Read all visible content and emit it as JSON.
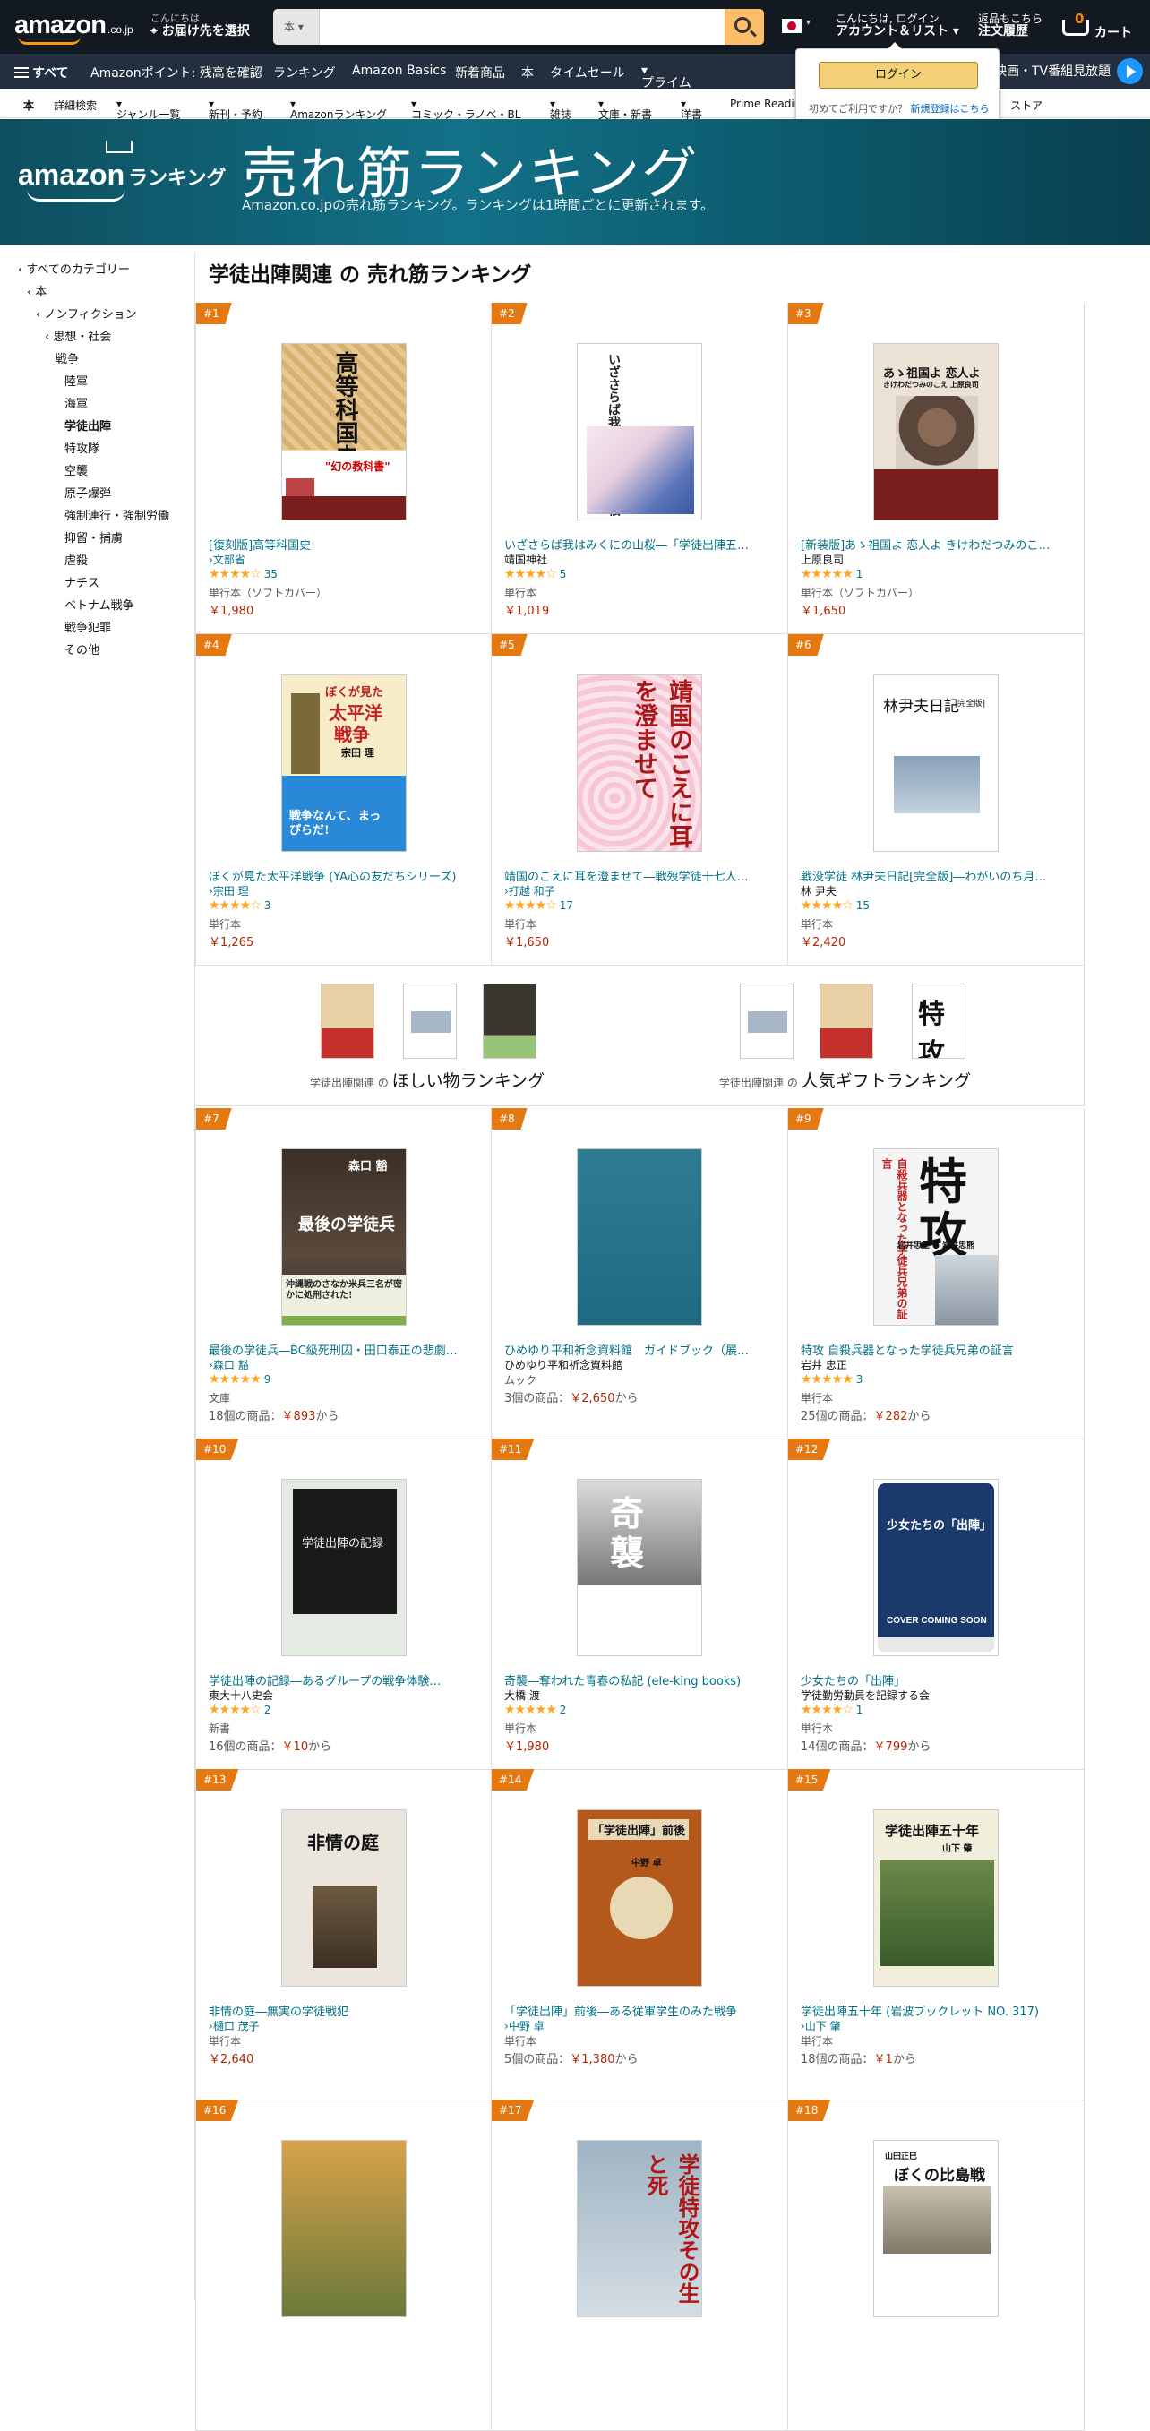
{
  "header": {
    "logo": "amazon",
    "logo_domain": ".co.jp",
    "deliver_line1": "こんにちは",
    "deliver_line2": "お届け先を選択",
    "search_category": "本",
    "search_placeholder": "",
    "account_line1": "こんにちは, ログイン",
    "account_line2": "アカウント＆リスト",
    "orders_line1": "返品もこちら",
    "orders_line2": "注文履歴",
    "cart_count": "0",
    "cart_label": "カート"
  },
  "nav": {
    "all": "すべて",
    "items": [
      "Amazonポイント: 残高を確認",
      "ランキング",
      "Amazon Basics",
      "新着商品",
      "本",
      "タイムセール",
      "プライム"
    ],
    "prime_video": "映画・TV番組見放題"
  },
  "subnav": [
    "本",
    "詳細検索",
    "ジャンル一覧",
    "新刊・予約",
    "Amazonランキング",
    "コミック・ラノベ・BL",
    "雑誌",
    "文庫・新書",
    "洋書",
    "Prime Reading",
    "ストア"
  ],
  "signin_popover": {
    "button": "ログイン",
    "text": "初めてご利用ですか？",
    "link": "新規登録はこちら"
  },
  "banner": {
    "logo_text": "amazon",
    "logo_sub": "ランキング",
    "title": "売れ筋ランキング",
    "subtitle": "Amazon.co.jpの売れ筋ランキング。ランキングは1時間ごとに更新されます。"
  },
  "sidebar": [
    "‹ すべてのカテゴリー",
    "‹ 本",
    "‹ ノンフィクション",
    "‹ 思想・社会",
    "戦争",
    "陸軍",
    "海軍",
    "学徒出陣",
    "特攻隊",
    "空襲",
    "原子爆弾",
    "強制連行・強制労働",
    "抑留・捕虜",
    "虐殺",
    "ナチス",
    "ベトナム戦争",
    "戦争犯罪",
    "その他"
  ],
  "page_title": "学徒出陣関連 の 売れ筋ランキング",
  "products": [
    {
      "rank": "#1",
      "title": "[復刻版]高等科国史",
      "author": "文部省",
      "author_link": true,
      "stars": "★★★★☆",
      "reviews": "35",
      "format": "単行本（ソフトカバー）",
      "price": "￥1,980",
      "price_suffix": ""
    },
    {
      "rank": "#2",
      "title": "いざさらば我はみくにの山桜―「学徒出陣五…",
      "author": "靖国神社",
      "author_link": false,
      "stars": "★★★★☆",
      "reviews": "5",
      "format": "単行本",
      "price": "￥1,019",
      "price_suffix": ""
    },
    {
      "rank": "#3",
      "title": "[新装版]あゝ祖国よ 恋人よ きけわだつみのこ…",
      "author": "上原良司",
      "author_link": false,
      "stars": "★★★★★",
      "reviews": "1",
      "format": "単行本（ソフトカバー）",
      "price": "￥1,650",
      "price_suffix": ""
    },
    {
      "rank": "#4",
      "title": "ぼくが見た太平洋戦争 (YA心の友だちシリーズ)",
      "author": "宗田 理",
      "author_link": true,
      "stars": "★★★★☆",
      "reviews": "3",
      "format": "単行本",
      "price": "￥1,265",
      "price_suffix": ""
    },
    {
      "rank": "#5",
      "title": "靖国のこえに耳を澄ませて―戦歿学徒十七人…",
      "author": "打越 和子",
      "author_link": true,
      "stars": "★★★★☆",
      "reviews": "17",
      "format": "単行本",
      "price": "￥1,650",
      "price_suffix": ""
    },
    {
      "rank": "#6",
      "title": "戦没学徒 林尹夫日記[完全版]―わがいのち月…",
      "author": "林 尹夫",
      "author_link": false,
      "stars": "★★★★☆",
      "reviews": "15",
      "format": "単行本",
      "price": "￥2,420",
      "price_suffix": ""
    },
    {
      "rank": "#7",
      "title": "最後の学徒兵―BC級死刑囚・田口泰正の悲劇…",
      "author": "森口 豁",
      "author_link": true,
      "stars": "★★★★★",
      "reviews": "9",
      "format": "文庫",
      "price": "￥893",
      "price_prefix": "18個の商品：",
      "price_suffix": "から"
    },
    {
      "rank": "#8",
      "title": "ひめゆり平和祈念資料館　ガイドブック（展…",
      "author": "ひめゆり平和祈念資料館",
      "author_link": false,
      "stars": "",
      "reviews": "",
      "format": "ムック",
      "price": "￥2,650",
      "price_prefix": "3個の商品：",
      "price_suffix": "から"
    },
    {
      "rank": "#9",
      "title": "特攻 自殺兵器となった学徒兵兄弟の証言",
      "author": "岩井 忠正",
      "author_link": false,
      "stars": "★★★★★",
      "reviews": "3",
      "format": "単行本",
      "price": "￥282",
      "price_prefix": "25個の商品：",
      "price_suffix": "から"
    },
    {
      "rank": "#10",
      "title": "学徒出陣の記録―あるグループの戦争体験…",
      "author": "東大十八史会",
      "author_link": false,
      "stars": "★★★★☆",
      "reviews": "2",
      "format": "新書",
      "price": "￥10",
      "price_prefix": "16個の商品：",
      "price_suffix": "から"
    },
    {
      "rank": "#11",
      "title": "奇襲―奪われた青春の私記 (ele-king books)",
      "author": "大橋 渡",
      "author_link": false,
      "stars": "★★★★★",
      "reviews": "2",
      "format": "単行本",
      "price": "￥1,980",
      "price_suffix": ""
    },
    {
      "rank": "#12",
      "title": "少女たちの「出陣」",
      "author": "学徒勤労動員を記録する会",
      "author_link": false,
      "stars": "★★★★☆",
      "reviews": "1",
      "format": "単行本",
      "price": "￥799",
      "price_prefix": "14個の商品：",
      "price_suffix": "から"
    },
    {
      "rank": "#13",
      "title": "非情の庭―無実の学徒戦犯",
      "author": "樋口 茂子",
      "author_link": true,
      "stars": "",
      "reviews": "",
      "format": "単行本",
      "price": "￥2,640",
      "price_suffix": ""
    },
    {
      "rank": "#14",
      "title": "「学徒出陣」前後―ある従軍学生のみた戦争",
      "author": "中野 卓",
      "author_link": true,
      "stars": "",
      "reviews": "",
      "format": "単行本",
      "price": "￥1,380",
      "price_prefix": "5個の商品：",
      "price_suffix": "から"
    },
    {
      "rank": "#15",
      "title": "学徒出陣五十年 (岩波ブックレット NO. 317)",
      "author": "山下 肇",
      "author_link": true,
      "stars": "",
      "reviews": "",
      "format": "単行本",
      "price": "￥1",
      "price_prefix": "18個の商品：",
      "price_suffix": "から"
    },
    {
      "rank": "#16"
    },
    {
      "rank": "#17"
    },
    {
      "rank": "#18"
    }
  ],
  "promo": {
    "left_prefix": "学徒出陣関連 の",
    "left_title": "ほしい物ランキング",
    "right_prefix": "学徒出陣関連 の",
    "right_title": "人気ギフトランキング"
  },
  "covers": {
    "c1_title": "高等科国史",
    "c1_badge": "\"幻の教科書\"",
    "c2_title": "いざさらば我はみくにの山桜",
    "c3_title": "あゝ祖国よ 恋人よ",
    "c3_sub": "きけわだつみのこえ 上原良司",
    "c4_a": "ぼくが見た",
    "c4_b": "太平洋",
    "c4_c": "戦争",
    "c4_author": "宗田 理",
    "c4_slogan": "戦争なんて、まっぴらだ!",
    "c5_title": "靖国のこえに耳を澄ませて",
    "c6_title": "林尹夫日記",
    "c6_tag": "[完全版]",
    "c7_author": "森口 豁",
    "c7_title": "最後の学徒兵",
    "c7_band": "沖縄戦のさなか米兵三名が密かに処刑された!",
    "c9_title": "特攻",
    "c9_sub": "自殺兵器となった学徒兵兄弟の証言",
    "c9_author": "岩井忠正 ● 岩井忠熊",
    "c10_title": "学徒出陣の記録",
    "c11_title": "奇襲",
    "c12_title": "少女たちの「出陣」",
    "c12_soon": "COVER COMING SOON",
    "c13_title": "非情の庭",
    "c14_title": "「学徒出陣」前後",
    "c14_author": "中野 卓",
    "c15_title": "学徒出陣五十年",
    "c15_author": "山下 肇",
    "c17_title": "学徒特攻その生と死",
    "c18_title": "ぼくの比島戦記",
    "c18_top": "山田正巳"
  },
  "colors": {
    "nav_bg": "#131921",
    "nav2_bg": "#232f3e",
    "accent": "#ff9900",
    "rank_badge": "#e47911",
    "link": "#007185",
    "price": "#b12704",
    "star": "#ffa41c",
    "banner": "#127188"
  }
}
